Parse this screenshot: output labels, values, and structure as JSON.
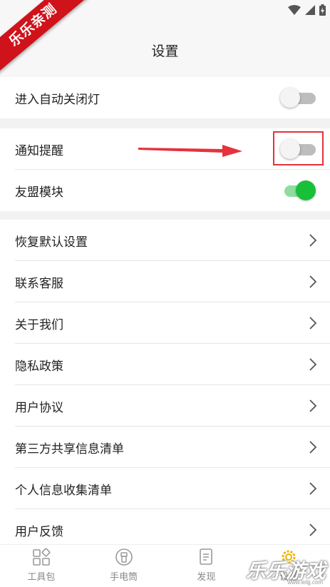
{
  "header": {
    "title": "设置"
  },
  "corner_badge": "乐乐亲测",
  "groups": {
    "g1": [
      {
        "label": "进入自动关闭灯",
        "toggle": false
      }
    ],
    "g2": [
      {
        "label": "通知提醒",
        "toggle": false
      },
      {
        "label": "友盟模块",
        "toggle": true
      }
    ],
    "g3": [
      {
        "label": "恢复默认设置"
      },
      {
        "label": "联系客服"
      },
      {
        "label": "关于我们"
      },
      {
        "label": "隐私政策"
      },
      {
        "label": "用户协议"
      },
      {
        "label": "第三方共享信息清单"
      },
      {
        "label": "个人信息收集清单"
      },
      {
        "label": "用户反馈"
      }
    ]
  },
  "tabbar": [
    {
      "label": "工具包",
      "icon": "toolkit-icon"
    },
    {
      "label": "手电筒",
      "icon": "flashlight-icon"
    },
    {
      "label": "发现",
      "icon": "discover-icon"
    },
    {
      "label": "设置",
      "icon": "settings-icon"
    }
  ],
  "watermark": {
    "text": "乐乐游戏",
    "url": "www.lelijj.com"
  },
  "colors": {
    "toggle_on": "#18c03a",
    "toggle_off": "#bdbdbd",
    "annotation": "#e5323c",
    "badge": "#d0121b"
  }
}
